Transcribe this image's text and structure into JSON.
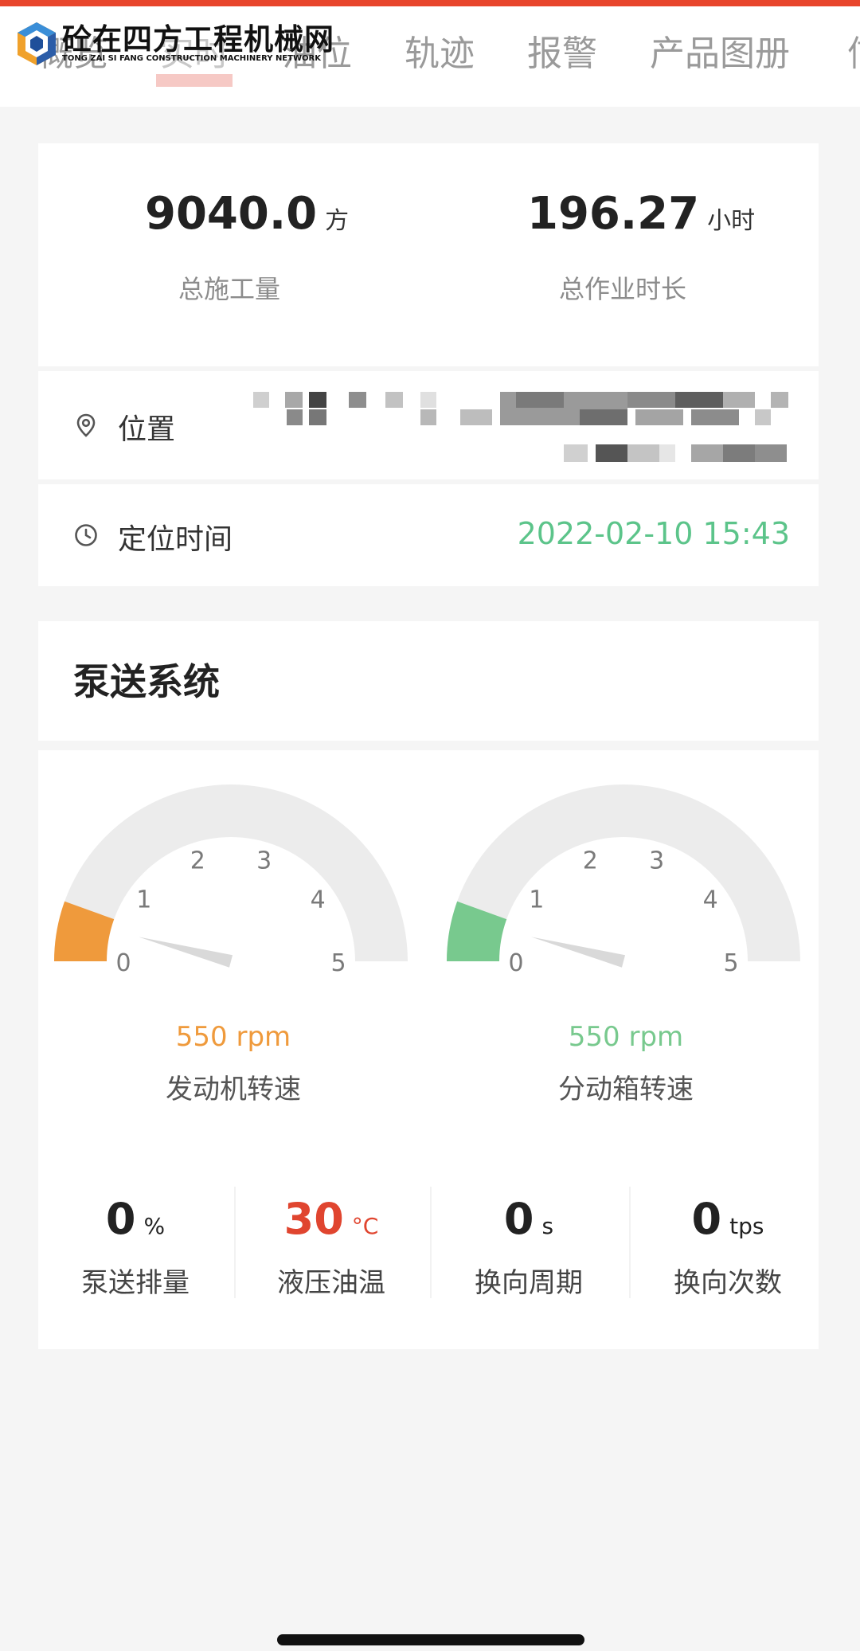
{
  "watermark": {
    "title": "砼在四方工程机械网",
    "subtitle": "TONG ZAI SI FANG CONSTRUCTION MACHINERY NETWORK"
  },
  "tabs": [
    {
      "label": "概览",
      "active": false
    },
    {
      "label": "实时",
      "active": true
    },
    {
      "label": "油位",
      "active": false
    },
    {
      "label": "轨迹",
      "active": false
    },
    {
      "label": "报警",
      "active": false
    },
    {
      "label": "产品图册",
      "active": false
    },
    {
      "label": "信",
      "active": false
    }
  ],
  "summary": {
    "total_volume": {
      "value": "9040.0",
      "unit": "方",
      "label": "总施工量"
    },
    "total_hours": {
      "value": "196.27",
      "unit": "小时",
      "label": "总作业时长"
    }
  },
  "location": {
    "label": "位置",
    "icon": "location-pin-icon"
  },
  "locate_time": {
    "label": "定位时间",
    "value": "2022-02-10 15:43",
    "icon": "clock-icon"
  },
  "pump_system": {
    "title": "泵送系统",
    "gauges": [
      {
        "reading": "550 rpm",
        "label": "发动机转速",
        "color": "#ef9a3c",
        "ticks": [
          "0",
          "1",
          "2",
          "3",
          "4",
          "5"
        ],
        "value": 0.55,
        "max": 5
      },
      {
        "reading": "550 rpm",
        "label": "分动箱转速",
        "color": "#78c98e",
        "ticks": [
          "0",
          "1",
          "2",
          "3",
          "4",
          "5"
        ],
        "value": 0.55,
        "max": 5
      }
    ],
    "metrics": [
      {
        "value": "0",
        "unit": "%",
        "label": "泵送排量",
        "color": "#222222"
      },
      {
        "value": "30",
        "unit": "°C",
        "label": "液压油温",
        "color": "#e0452f"
      },
      {
        "value": "0",
        "unit": "s",
        "label": "换向周期",
        "color": "#222222"
      },
      {
        "value": "0",
        "unit": "tps",
        "label": "换向次数",
        "color": "#222222"
      }
    ]
  },
  "colors": {
    "accent": "#e8452c",
    "green": "#5cc48a",
    "orange": "#ef9a3c",
    "red": "#e0452f"
  }
}
